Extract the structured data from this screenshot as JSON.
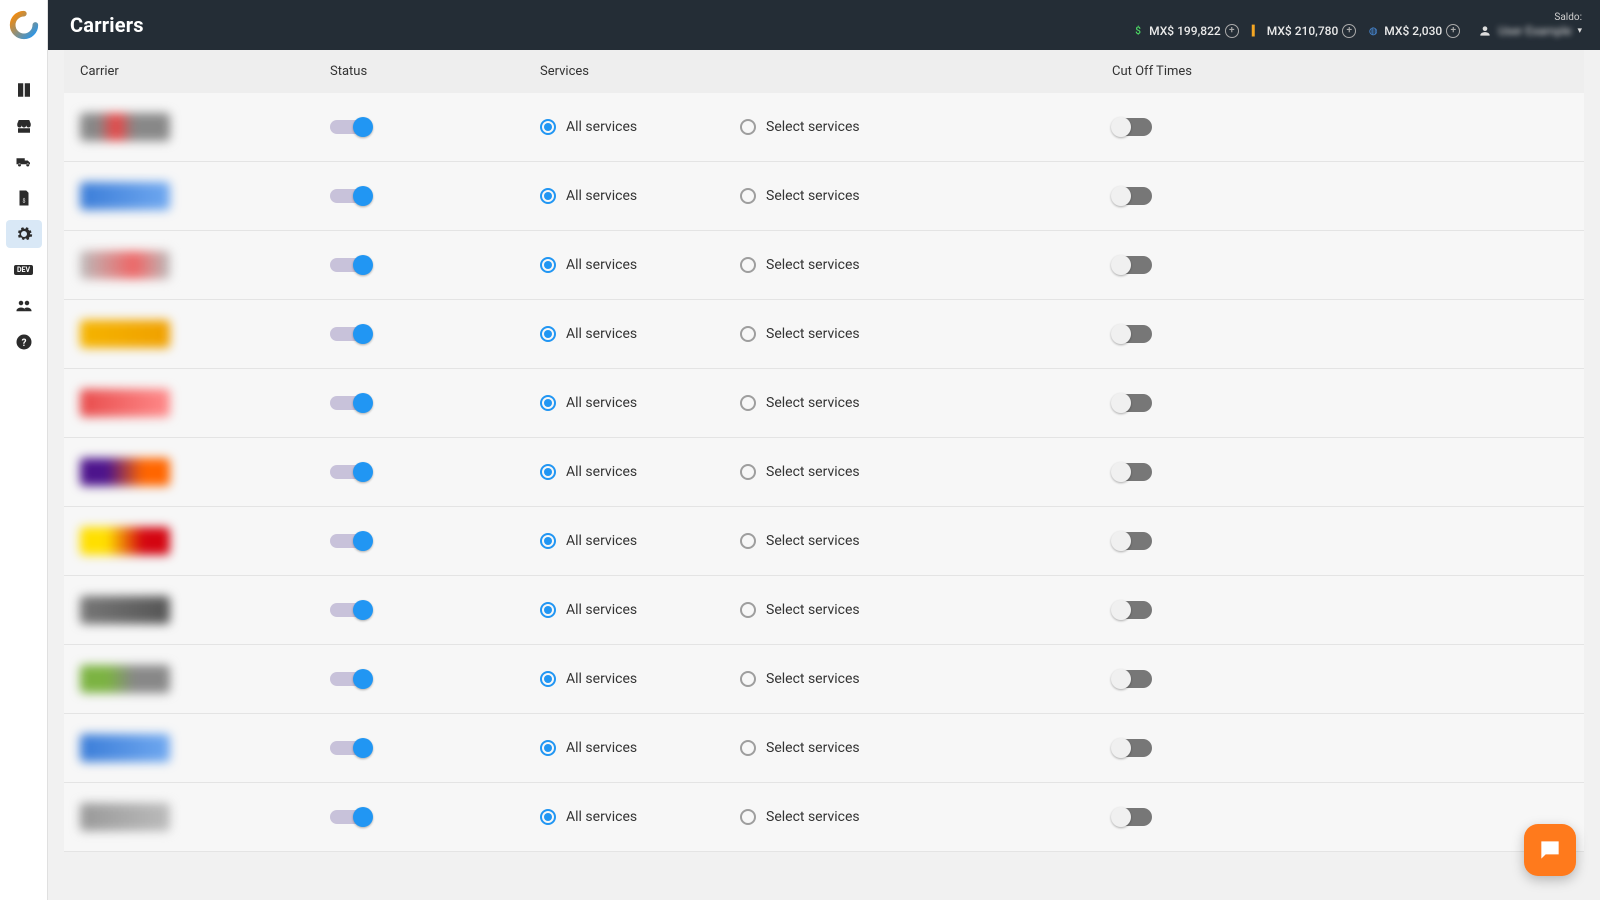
{
  "header": {
    "title": "Carriers",
    "saldo_label": "Saldo:",
    "balances": [
      {
        "icon": "dollar",
        "text": "MX$ 199,822"
      },
      {
        "icon": "flag",
        "text": "MX$ 210,780"
      },
      {
        "icon": "globe",
        "text": "MX$ 2,030"
      }
    ],
    "user_name": "User Example"
  },
  "sidebar": {
    "items": [
      {
        "name": "nav-book",
        "icon": "book"
      },
      {
        "name": "nav-store",
        "icon": "store"
      },
      {
        "name": "nav-truck",
        "icon": "truck"
      },
      {
        "name": "nav-invoice",
        "icon": "invoice"
      },
      {
        "name": "nav-settings",
        "icon": "gear",
        "active": true
      },
      {
        "name": "nav-dev",
        "icon": "dev"
      },
      {
        "name": "nav-users",
        "icon": "users"
      },
      {
        "name": "nav-help",
        "icon": "help"
      }
    ]
  },
  "table": {
    "columns": {
      "carrier": "Carrier",
      "status": "Status",
      "services": "Services",
      "cutoff": "Cut Off Times"
    },
    "labels": {
      "all_services": "All services",
      "select_services": "Select services"
    },
    "rows": [
      {
        "logo_bg": "linear-gradient(90deg,#888 20%,#e44 40%,#888 60%)"
      },
      {
        "logo_bg": "linear-gradient(90deg,#3b7dd8 0%,#6fa8f0 100%)"
      },
      {
        "logo_bg": "linear-gradient(90deg,#bbb 0%,#e66 60%,#bbb 100%)"
      },
      {
        "logo_bg": "linear-gradient(90deg,#f5b400 0%,#f0a000 100%)"
      },
      {
        "logo_bg": "linear-gradient(90deg,#e84c4c 0%,#ff8a8a 100%)"
      },
      {
        "logo_bg": "linear-gradient(90deg,#4d148c 30%,#ff6600 70%)"
      },
      {
        "logo_bg": "linear-gradient(90deg,#ffdf00 30%,#d40511 70%)"
      },
      {
        "logo_bg": "linear-gradient(90deg,#777 0%,#555 100%)"
      },
      {
        "logo_bg": "linear-gradient(90deg,#7cb342 30%,#888 60%)"
      },
      {
        "logo_bg": "linear-gradient(90deg,#3b7dd8 0%,#6fa8f0 100%)"
      },
      {
        "logo_bg": "linear-gradient(90deg,#999 0%,#bbb 100%)"
      }
    ]
  }
}
